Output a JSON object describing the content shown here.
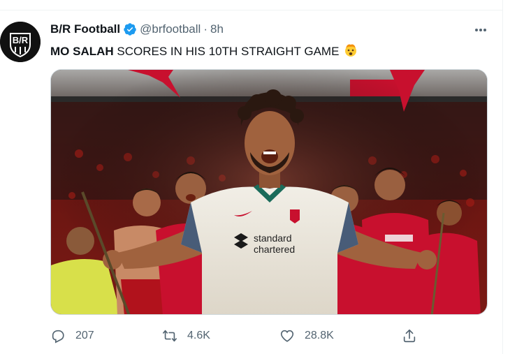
{
  "tweet": {
    "display_name": "B/R Football",
    "handle": "@brfootball",
    "separator": "·",
    "time": "8h",
    "text_bold": "MO SALAH",
    "text_rest": " SCORES IN HIS 10TH STRAIGHT GAME",
    "emoji": "exploding-head-emoji",
    "avatar_logo_text": "B/R"
  },
  "media": {
    "sponsor_lines": [
      "standard",
      "chartered"
    ]
  },
  "actions": {
    "reply_count": "207",
    "retweet_count": "4.6K",
    "like_count": "28.8K"
  },
  "colors": {
    "verified": "#1d9bf0",
    "muted": "#536471",
    "text": "#0f1419",
    "divider": "#eff3f4"
  }
}
